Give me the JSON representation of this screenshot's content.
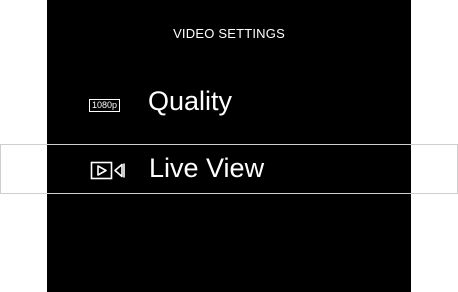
{
  "header": {
    "title": "VIDEO SETTINGS"
  },
  "menu": {
    "items": [
      {
        "label": "Quality",
        "badge": "1080p",
        "icon": "resolution-badge-icon",
        "selected": false
      },
      {
        "label": "Live View",
        "icon": "live-view-icon",
        "selected": true
      }
    ]
  },
  "colors": {
    "background": "#000000",
    "text": "#ffffff",
    "selection_border": "#cfcfcf",
    "page": "#ffffff"
  }
}
